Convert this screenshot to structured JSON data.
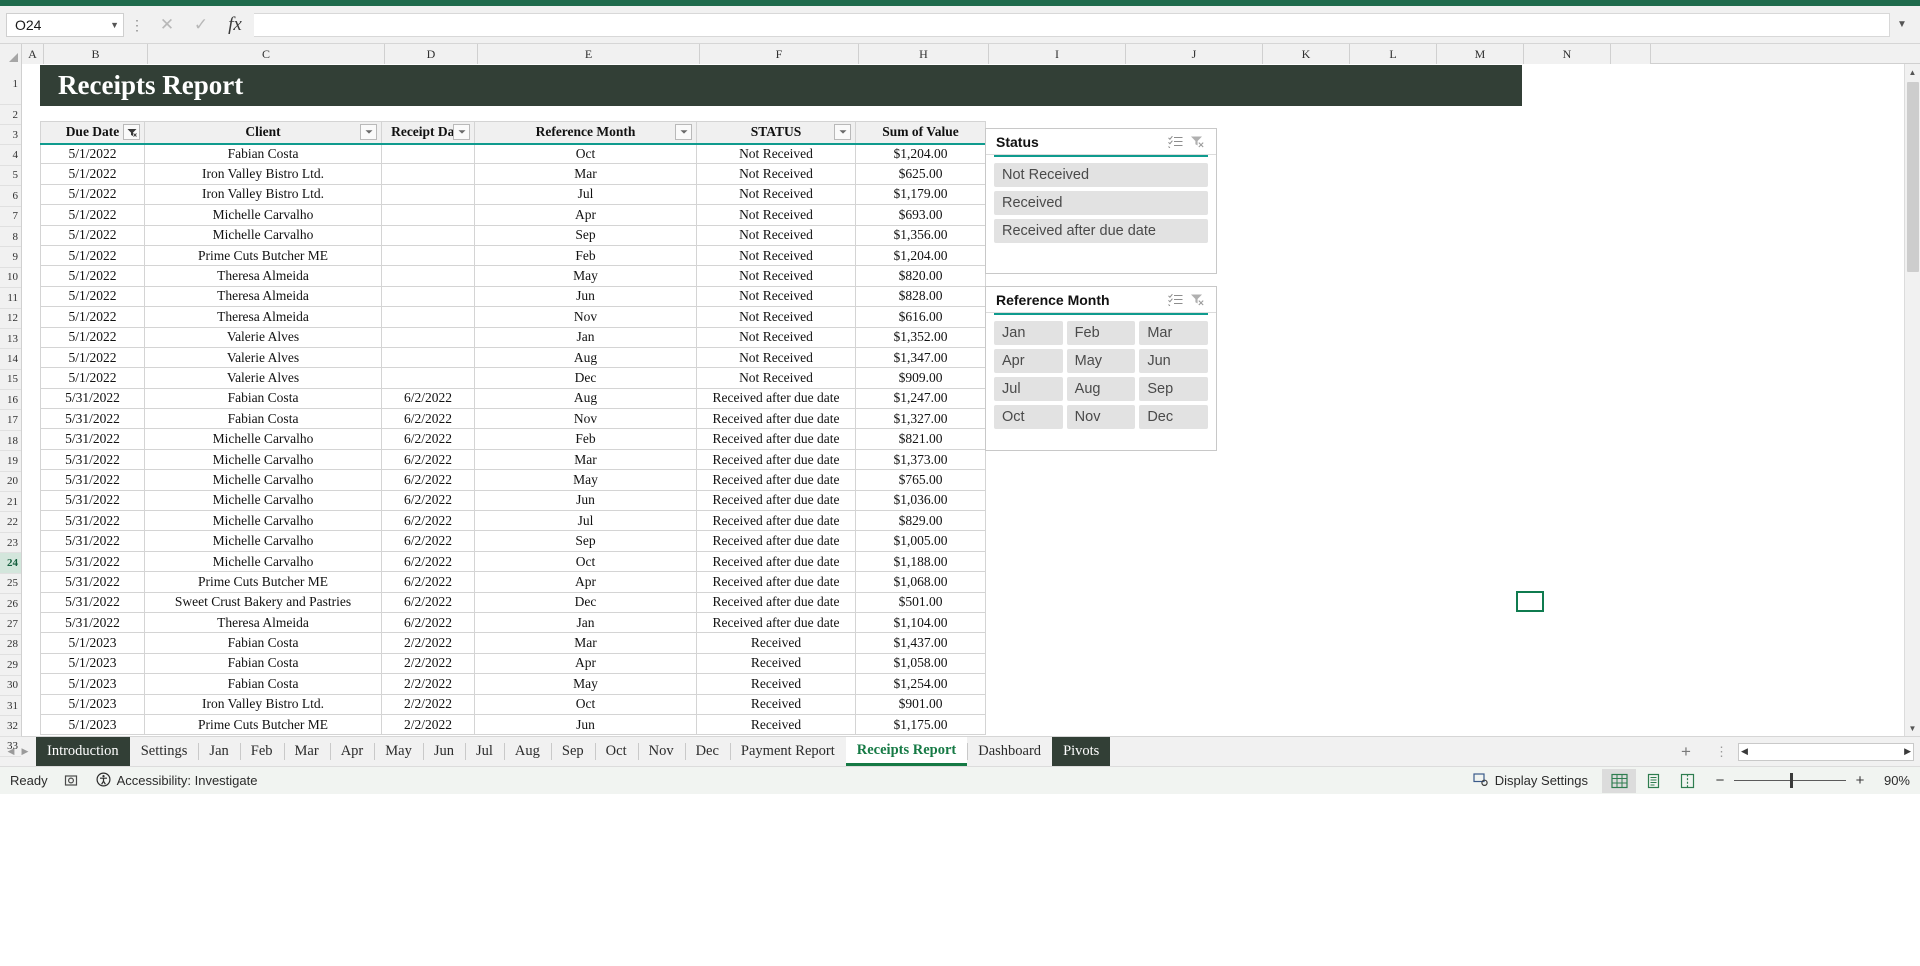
{
  "window": {
    "name_box_value": "O24",
    "formula_value": "",
    "cancel_icon": "close-icon",
    "confirm_icon": "check-icon",
    "function_icon": "fx-icon"
  },
  "grid": {
    "columns": [
      "A",
      "B",
      "C",
      "D",
      "E",
      "F",
      "H",
      "I",
      "J",
      "K",
      "L",
      "M",
      "N"
    ],
    "selected_column": "O",
    "rows": [
      "1",
      "2",
      "3",
      "4",
      "5",
      "6",
      "7",
      "8",
      "9",
      "10",
      "11",
      "12",
      "13",
      "14",
      "15",
      "16",
      "17",
      "18",
      "19",
      "20",
      "21",
      "22",
      "23",
      "24",
      "25",
      "26",
      "27",
      "28",
      "29",
      "30",
      "31",
      "32",
      "33"
    ],
    "selected_row": "24"
  },
  "report": {
    "title": "Receipts Report",
    "title_bg": "#323f36",
    "accent": "#0f9b8e"
  },
  "table": {
    "headers": [
      {
        "label": "Due Date",
        "filter_state": "filtered",
        "icon": "filter-active-icon"
      },
      {
        "label": "Client",
        "filter_state": "none",
        "icon": "chevron-down-icon"
      },
      {
        "label": "Receipt Date",
        "filter_state": "none",
        "icon": "chevron-down-icon"
      },
      {
        "label": "Reference Month",
        "filter_state": "none",
        "icon": "chevron-down-icon"
      },
      {
        "label": "STATUS",
        "filter_state": "none",
        "icon": "chevron-down-icon"
      },
      {
        "label": "Sum of Value",
        "filter_state": "none",
        "icon": ""
      }
    ],
    "rows": [
      {
        "row": "4",
        "due": "5/1/2022",
        "client": "Fabian Costa",
        "receipt": "",
        "month": "Oct",
        "status": "Not Received",
        "value": "$1,204.00"
      },
      {
        "row": "5",
        "due": "5/1/2022",
        "client": "Iron Valley Bistro Ltd.",
        "receipt": "",
        "month": "Mar",
        "status": "Not Received",
        "value": "$625.00"
      },
      {
        "row": "6",
        "due": "5/1/2022",
        "client": "Iron Valley Bistro Ltd.",
        "receipt": "",
        "month": "Jul",
        "status": "Not Received",
        "value": "$1,179.00"
      },
      {
        "row": "7",
        "due": "5/1/2022",
        "client": "Michelle Carvalho",
        "receipt": "",
        "month": "Apr",
        "status": "Not Received",
        "value": "$693.00"
      },
      {
        "row": "8",
        "due": "5/1/2022",
        "client": "Michelle Carvalho",
        "receipt": "",
        "month": "Sep",
        "status": "Not Received",
        "value": "$1,356.00"
      },
      {
        "row": "9",
        "due": "5/1/2022",
        "client": "Prime Cuts Butcher ME",
        "receipt": "",
        "month": "Feb",
        "status": "Not Received",
        "value": "$1,204.00"
      },
      {
        "row": "10",
        "due": "5/1/2022",
        "client": "Theresa Almeida",
        "receipt": "",
        "month": "May",
        "status": "Not Received",
        "value": "$820.00"
      },
      {
        "row": "11",
        "due": "5/1/2022",
        "client": "Theresa Almeida",
        "receipt": "",
        "month": "Jun",
        "status": "Not Received",
        "value": "$828.00"
      },
      {
        "row": "12",
        "due": "5/1/2022",
        "client": "Theresa Almeida",
        "receipt": "",
        "month": "Nov",
        "status": "Not Received",
        "value": "$616.00"
      },
      {
        "row": "13",
        "due": "5/1/2022",
        "client": "Valerie Alves",
        "receipt": "",
        "month": "Jan",
        "status": "Not Received",
        "value": "$1,352.00"
      },
      {
        "row": "14",
        "due": "5/1/2022",
        "client": "Valerie Alves",
        "receipt": "",
        "month": "Aug",
        "status": "Not Received",
        "value": "$1,347.00"
      },
      {
        "row": "15",
        "due": "5/1/2022",
        "client": "Valerie Alves",
        "receipt": "",
        "month": "Dec",
        "status": "Not Received",
        "value": "$909.00"
      },
      {
        "row": "16",
        "due": "5/31/2022",
        "client": "Fabian Costa",
        "receipt": "6/2/2022",
        "month": "Aug",
        "status": "Received after due date",
        "value": "$1,247.00"
      },
      {
        "row": "17",
        "due": "5/31/2022",
        "client": "Fabian Costa",
        "receipt": "6/2/2022",
        "month": "Nov",
        "status": "Received after due date",
        "value": "$1,327.00"
      },
      {
        "row": "18",
        "due": "5/31/2022",
        "client": "Michelle Carvalho",
        "receipt": "6/2/2022",
        "month": "Feb",
        "status": "Received after due date",
        "value": "$821.00"
      },
      {
        "row": "19",
        "due": "5/31/2022",
        "client": "Michelle Carvalho",
        "receipt": "6/2/2022",
        "month": "Mar",
        "status": "Received after due date",
        "value": "$1,373.00"
      },
      {
        "row": "20",
        "due": "5/31/2022",
        "client": "Michelle Carvalho",
        "receipt": "6/2/2022",
        "month": "May",
        "status": "Received after due date",
        "value": "$765.00"
      },
      {
        "row": "21",
        "due": "5/31/2022",
        "client": "Michelle Carvalho",
        "receipt": "6/2/2022",
        "month": "Jun",
        "status": "Received after due date",
        "value": "$1,036.00"
      },
      {
        "row": "22",
        "due": "5/31/2022",
        "client": "Michelle Carvalho",
        "receipt": "6/2/2022",
        "month": "Jul",
        "status": "Received after due date",
        "value": "$829.00"
      },
      {
        "row": "23",
        "due": "5/31/2022",
        "client": "Michelle Carvalho",
        "receipt": "6/2/2022",
        "month": "Sep",
        "status": "Received after due date",
        "value": "$1,005.00"
      },
      {
        "row": "24",
        "due": "5/31/2022",
        "client": "Michelle Carvalho",
        "receipt": "6/2/2022",
        "month": "Oct",
        "status": "Received after due date",
        "value": "$1,188.00"
      },
      {
        "row": "25",
        "due": "5/31/2022",
        "client": "Prime Cuts Butcher ME",
        "receipt": "6/2/2022",
        "month": "Apr",
        "status": "Received after due date",
        "value": "$1,068.00"
      },
      {
        "row": "26",
        "due": "5/31/2022",
        "client": "Sweet Crust Bakery and Pastries",
        "receipt": "6/2/2022",
        "month": "Dec",
        "status": "Received after due date",
        "value": "$501.00"
      },
      {
        "row": "27",
        "due": "5/31/2022",
        "client": "Theresa Almeida",
        "receipt": "6/2/2022",
        "month": "Jan",
        "status": "Received after due date",
        "value": "$1,104.00"
      },
      {
        "row": "28",
        "due": "5/1/2023",
        "client": "Fabian Costa",
        "receipt": "2/2/2022",
        "month": "Mar",
        "status": "Received",
        "value": "$1,437.00"
      },
      {
        "row": "29",
        "due": "5/1/2023",
        "client": "Fabian Costa",
        "receipt": "2/2/2022",
        "month": "Apr",
        "status": "Received",
        "value": "$1,058.00"
      },
      {
        "row": "30",
        "due": "5/1/2023",
        "client": "Fabian Costa",
        "receipt": "2/2/2022",
        "month": "May",
        "status": "Received",
        "value": "$1,254.00"
      },
      {
        "row": "31",
        "due": "5/1/2023",
        "client": "Iron Valley Bistro Ltd.",
        "receipt": "2/2/2022",
        "month": "Oct",
        "status": "Received",
        "value": "$901.00"
      },
      {
        "row": "32",
        "due": "5/1/2023",
        "client": "Prime Cuts Butcher ME",
        "receipt": "2/2/2022",
        "month": "Jun",
        "status": "Received",
        "value": "$1,175.00"
      }
    ]
  },
  "slicers": [
    {
      "title": "Status",
      "multiselect_icon": "multi-select-icon",
      "clear_icon": "clear-filter-icon",
      "layout": "list",
      "items": [
        "Not Received",
        "Received",
        "Received after due date"
      ]
    },
    {
      "title": "Reference Month",
      "multiselect_icon": "multi-select-icon",
      "clear_icon": "clear-filter-icon",
      "layout": "grid",
      "items": [
        "Jan",
        "Feb",
        "Mar",
        "Apr",
        "May",
        "Jun",
        "Jul",
        "Aug",
        "Sep",
        "Oct",
        "Nov",
        "Dec"
      ]
    }
  ],
  "sheet_tabs": {
    "prev_icon": "chevron-left-icon",
    "next_icon": "chevron-right-icon",
    "add_label": "+",
    "items": [
      {
        "label": "Introduction",
        "state": "dark"
      },
      {
        "label": "Settings",
        "state": "normal"
      },
      {
        "label": "Jan",
        "state": "normal"
      },
      {
        "label": "Feb",
        "state": "normal"
      },
      {
        "label": "Mar",
        "state": "normal"
      },
      {
        "label": "Apr",
        "state": "normal"
      },
      {
        "label": "May",
        "state": "normal"
      },
      {
        "label": "Jun",
        "state": "normal"
      },
      {
        "label": "Jul",
        "state": "normal"
      },
      {
        "label": "Aug",
        "state": "normal"
      },
      {
        "label": "Sep",
        "state": "normal"
      },
      {
        "label": "Oct",
        "state": "normal"
      },
      {
        "label": "Nov",
        "state": "normal"
      },
      {
        "label": "Dec",
        "state": "normal"
      },
      {
        "label": "Payment Report",
        "state": "normal"
      },
      {
        "label": "Receipts Report",
        "state": "active"
      },
      {
        "label": "Dashboard",
        "state": "normal"
      },
      {
        "label": "Pivots",
        "state": "dark"
      }
    ]
  },
  "status_bar": {
    "ready_label": "Ready",
    "record_icon": "macro-record-icon",
    "accessibility_icon": "accessibility-icon",
    "accessibility_label": "Accessibility: Investigate",
    "display_settings_icon": "display-settings-icon",
    "display_settings_label": "Display Settings",
    "view_normal_icon": "normal-view-icon",
    "view_pagelayout_icon": "page-layout-view-icon",
    "view_pagebreak_icon": "page-break-view-icon",
    "zoom_out": "−",
    "zoom_in": "+",
    "zoom_level": "90%"
  }
}
